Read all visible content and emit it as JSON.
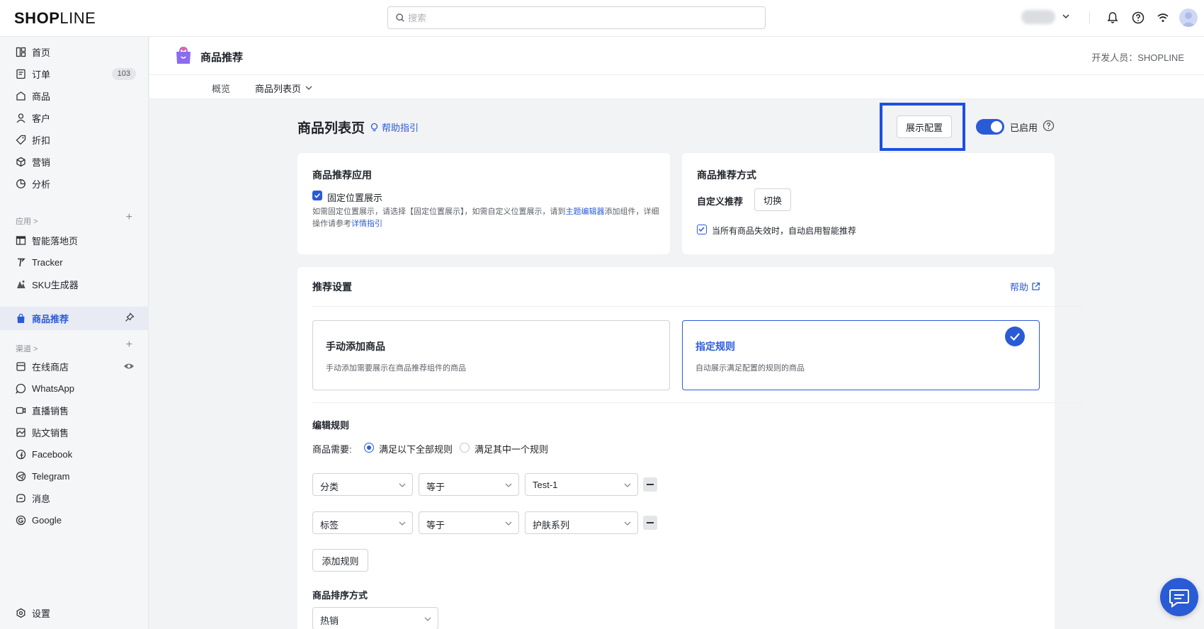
{
  "brand": {
    "logo_left": "SH",
    "logo_o": "O",
    "logo_p": "P",
    "logo_right": "LINE"
  },
  "search": {
    "placeholder": "搜索"
  },
  "sidebar": {
    "items": [
      {
        "label": "首页",
        "icon": "dashboard-icon"
      },
      {
        "label": "订单",
        "icon": "order-icon",
        "badge": "103"
      },
      {
        "label": "商品",
        "icon": "product-icon"
      },
      {
        "label": "客户",
        "icon": "customer-icon"
      },
      {
        "label": "折扣",
        "icon": "discount-tag-icon"
      },
      {
        "label": "营销",
        "icon": "marketing-icon"
      },
      {
        "label": "分析",
        "icon": "analytics-icon"
      }
    ],
    "apps_header": "应用 >",
    "apps": [
      {
        "label": "智能落地页",
        "icon": "landing-page-icon"
      },
      {
        "label": "Tracker",
        "icon": "tracker-icon"
      },
      {
        "label": "SKU生成器",
        "icon": "sku-generator-icon"
      }
    ],
    "active_app": {
      "label": "商品推荐",
      "icon": "product-recommend-icon"
    },
    "channels_header": "渠道 >",
    "channels": [
      {
        "label": "在线商店",
        "icon": "online-store-icon"
      },
      {
        "label": "WhatsApp",
        "icon": "whatsapp-icon"
      },
      {
        "label": "直播销售",
        "icon": "live-selling-icon"
      },
      {
        "label": "贴文销售",
        "icon": "post-selling-icon"
      },
      {
        "label": "Facebook",
        "icon": "facebook-icon"
      },
      {
        "label": "Telegram",
        "icon": "telegram-icon"
      },
      {
        "label": "消息",
        "icon": "message-icon"
      },
      {
        "label": "Google",
        "icon": "google-icon"
      }
    ],
    "settings": {
      "label": "设置",
      "icon": "settings-icon"
    }
  },
  "header": {
    "app_title": "商品推荐",
    "developer": "开发人员：SHOPLINE"
  },
  "subnav": {
    "overview": "概览",
    "list_page": "商品列表页"
  },
  "page": {
    "title": "商品列表页",
    "help_link": "帮助指引",
    "display_config_button": "展示配置",
    "enabled_label": "已启用",
    "enabled": true
  },
  "app_card": {
    "title": "商品推荐应用",
    "checkbox_label": "固定位置展示",
    "desc_part1": "如需固定位置展示，请选择【固定位置展示】，如需自定义位置展示，请到",
    "desc_link1": "主题编辑器",
    "desc_part2": "添加组件，详细",
    "desc_part3": "操作请参考",
    "desc_link2": "详情指引"
  },
  "method_card": {
    "title": "商品推荐方式",
    "mode_label": "自定义推荐",
    "switch_button": "切换",
    "fallback_label": "当所有商品失效时，自动启用智能推荐"
  },
  "settings_card": {
    "title": "推荐设置",
    "help": "帮助",
    "option_manual": {
      "title": "手动添加商品",
      "desc": "手动添加需要展示在商品推荐组件的商品"
    },
    "option_rule": {
      "title": "指定规则",
      "desc": "自动展示满足配置的规则的商品"
    },
    "edit_rules_title": "编辑规则",
    "match_label": "商品需要:",
    "match_all": "满足以下全部规则",
    "match_any": "满足其中一个规则",
    "rules": [
      {
        "field": "分类",
        "op": "等于",
        "value": "Test-1"
      },
      {
        "field": "标签",
        "op": "等于",
        "value": "护肤系列"
      }
    ],
    "add_rule_button": "添加规则",
    "sort_title": "商品排序方式",
    "sort_value": "热销"
  },
  "colors": {
    "accent": "#2a5bd7",
    "highlight_border": "#1d4fe3"
  }
}
